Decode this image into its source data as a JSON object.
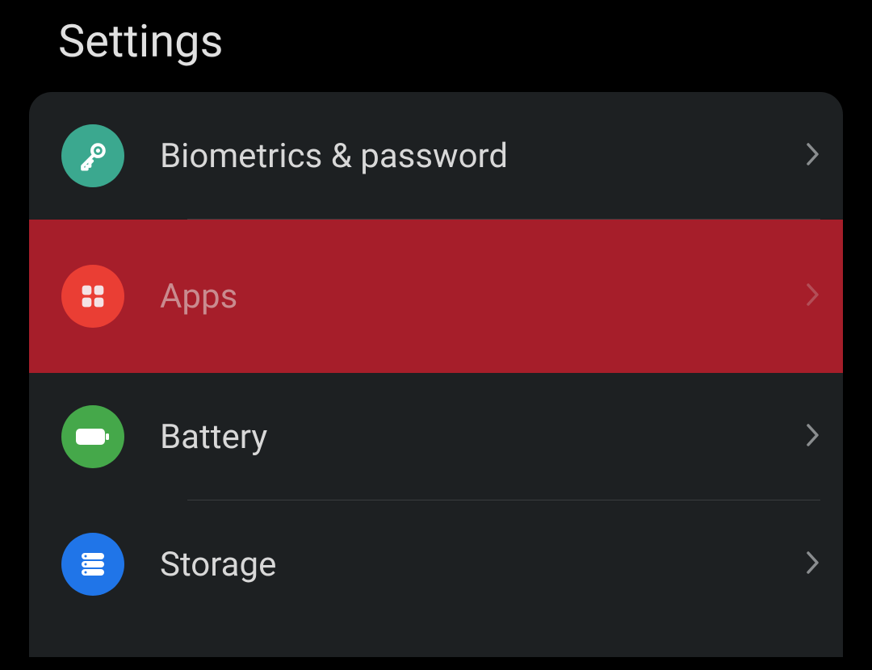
{
  "page": {
    "title": "Settings"
  },
  "items": [
    {
      "id": "biometrics",
      "label": "Biometrics & password",
      "highlighted": false
    },
    {
      "id": "apps",
      "label": "Apps",
      "highlighted": true
    },
    {
      "id": "battery",
      "label": "Battery",
      "highlighted": false
    },
    {
      "id": "storage",
      "label": "Storage",
      "highlighted": false
    }
  ]
}
